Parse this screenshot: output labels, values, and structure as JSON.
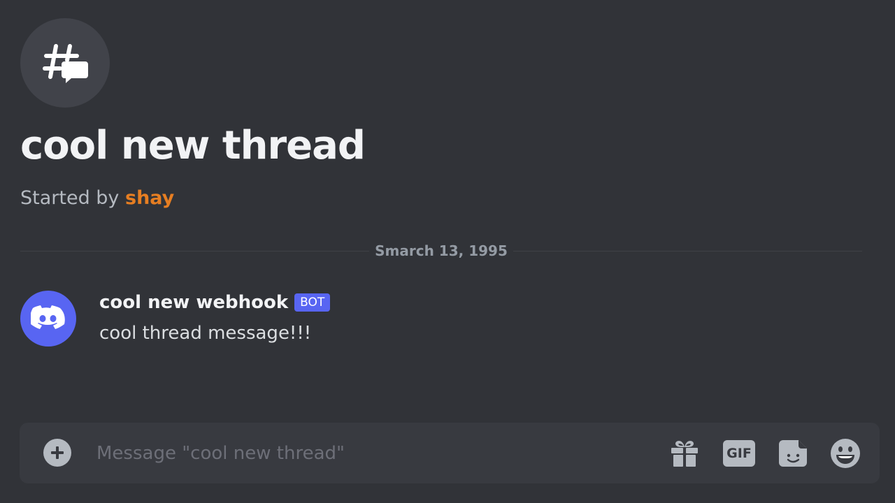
{
  "thread": {
    "icon": "thread-icon",
    "title": "cool new thread",
    "started_by_prefix": "Started by ",
    "author": "shay"
  },
  "divider": {
    "date": "Smarch 13, 1995"
  },
  "message": {
    "avatar_icon": "discord-logo-icon",
    "username": "cool new webhook",
    "badge": "BOT",
    "text": "cool thread message!!!"
  },
  "composer": {
    "placeholder": "Message \"cool new thread\"",
    "value": "",
    "gif_label": "GIF",
    "icons": [
      "add-circle-icon",
      "gift-icon",
      "gif-icon",
      "sticker-icon",
      "emoji-icon"
    ]
  },
  "colors": {
    "background": "#313338",
    "author": "#e67e22",
    "blurple": "#5865f2",
    "composer_bg": "#383a40"
  }
}
